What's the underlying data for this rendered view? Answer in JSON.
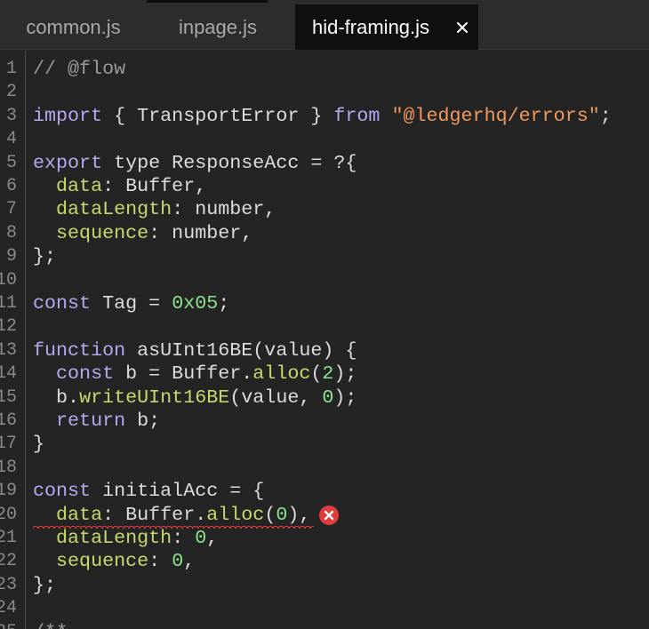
{
  "tabs": [
    {
      "label": "common.js",
      "active": false
    },
    {
      "label": "inpage.js",
      "active": false
    },
    {
      "label": "hid-framing.js",
      "active": true
    }
  ],
  "colors": {
    "keyword": "#b9a6ee",
    "string": "#f09a5e",
    "property": "#c7d96a",
    "number": "#8de28d",
    "comment": "#9a9a9a",
    "error": "#e03c3c"
  },
  "error_line": 20,
  "lines": [
    {
      "n": "1",
      "tokens": [
        [
          "comment",
          "// @flow"
        ]
      ]
    },
    {
      "n": "2",
      "tokens": []
    },
    {
      "n": "3",
      "tokens": [
        [
          "keyword",
          "import"
        ],
        [
          "plain",
          " { TransportError } "
        ],
        [
          "keyword",
          "from"
        ],
        [
          "plain",
          " "
        ],
        [
          "string",
          "\"@ledgerhq/errors\""
        ],
        [
          "plain",
          ";"
        ]
      ]
    },
    {
      "n": "4",
      "tokens": []
    },
    {
      "n": "5",
      "tokens": [
        [
          "keyword",
          "export"
        ],
        [
          "plain",
          " type ResponseAcc = ?{"
        ]
      ]
    },
    {
      "n": "6",
      "tokens": [
        [
          "plain",
          "  "
        ],
        [
          "property",
          "data"
        ],
        [
          "plain",
          ": Buffer,"
        ]
      ]
    },
    {
      "n": "7",
      "tokens": [
        [
          "plain",
          "  "
        ],
        [
          "property",
          "dataLength"
        ],
        [
          "plain",
          ": number,"
        ]
      ]
    },
    {
      "n": "8",
      "tokens": [
        [
          "plain",
          "  "
        ],
        [
          "property",
          "sequence"
        ],
        [
          "plain",
          ": number,"
        ]
      ]
    },
    {
      "n": "9",
      "tokens": [
        [
          "plain",
          "};"
        ]
      ]
    },
    {
      "n": "10",
      "tokens": []
    },
    {
      "n": "11",
      "tokens": [
        [
          "keyword",
          "const"
        ],
        [
          "plain",
          " Tag = "
        ],
        [
          "number",
          "0x05"
        ],
        [
          "plain",
          ";"
        ]
      ]
    },
    {
      "n": "12",
      "tokens": []
    },
    {
      "n": "13",
      "tokens": [
        [
          "keyword",
          "function"
        ],
        [
          "plain",
          " asUInt16BE(value) {"
        ]
      ]
    },
    {
      "n": "14",
      "tokens": [
        [
          "plain",
          "  "
        ],
        [
          "keyword",
          "const"
        ],
        [
          "plain",
          " b = Buffer."
        ],
        [
          "method",
          "alloc"
        ],
        [
          "plain",
          "("
        ],
        [
          "number",
          "2"
        ],
        [
          "plain",
          ");"
        ]
      ]
    },
    {
      "n": "15",
      "tokens": [
        [
          "plain",
          "  b."
        ],
        [
          "method",
          "writeUInt16BE"
        ],
        [
          "plain",
          "(value, "
        ],
        [
          "number",
          "0"
        ],
        [
          "plain",
          ");"
        ]
      ]
    },
    {
      "n": "16",
      "tokens": [
        [
          "plain",
          "  "
        ],
        [
          "keyword",
          "return"
        ],
        [
          "plain",
          " b;"
        ]
      ]
    },
    {
      "n": "17",
      "tokens": [
        [
          "plain",
          "}"
        ]
      ]
    },
    {
      "n": "18",
      "tokens": []
    },
    {
      "n": "19",
      "tokens": [
        [
          "keyword",
          "const"
        ],
        [
          "plain",
          " initialAcc = {"
        ]
      ]
    },
    {
      "n": "20",
      "tokens": [
        [
          "plain",
          "  "
        ],
        [
          "property",
          "data"
        ],
        [
          "plain",
          ": Buffer."
        ],
        [
          "method",
          "alloc"
        ],
        [
          "plain",
          "("
        ],
        [
          "number",
          "0"
        ],
        [
          "plain",
          "),"
        ]
      ]
    },
    {
      "n": "21",
      "tokens": [
        [
          "plain",
          "  "
        ],
        [
          "property",
          "dataLength"
        ],
        [
          "plain",
          ": "
        ],
        [
          "number",
          "0"
        ],
        [
          "plain",
          ","
        ]
      ]
    },
    {
      "n": "22",
      "tokens": [
        [
          "plain",
          "  "
        ],
        [
          "property",
          "sequence"
        ],
        [
          "plain",
          ": "
        ],
        [
          "number",
          "0"
        ],
        [
          "plain",
          ","
        ]
      ]
    },
    {
      "n": "23",
      "tokens": [
        [
          "plain",
          "};"
        ]
      ]
    },
    {
      "n": "24",
      "tokens": []
    },
    {
      "n": "25",
      "tokens": [
        [
          "comment",
          "/**"
        ]
      ]
    }
  ]
}
